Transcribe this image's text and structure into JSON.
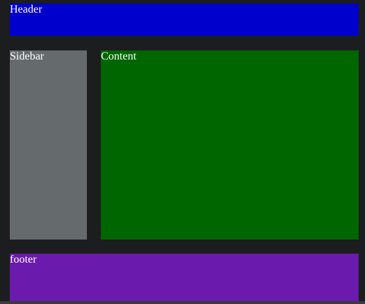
{
  "header": {
    "label": "Header"
  },
  "sidebar": {
    "label": "Sidebar"
  },
  "content": {
    "label": "Content"
  },
  "footer": {
    "label": "footer"
  },
  "colors": {
    "background": "#1c1d1e",
    "header": "#0000cc",
    "sidebar": "#656a6d",
    "content": "#006600",
    "footer": "#6a1aac",
    "text": "#ffffff"
  }
}
